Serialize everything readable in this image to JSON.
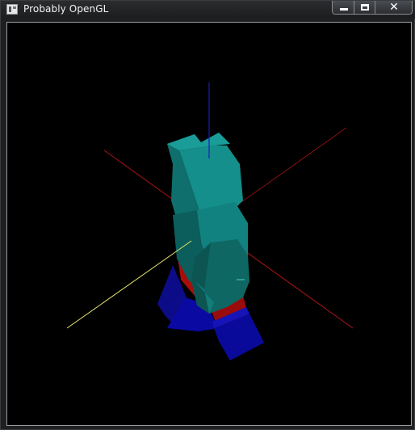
{
  "window": {
    "title": "Probably OpenGL",
    "controls": {
      "minimize_icon": "minimize-icon",
      "maximize_icon": "maximize-icon",
      "close_glyph": "✕"
    }
  },
  "scene": {
    "background": "#000000",
    "axis_colors": {
      "x": "#cc1a1a",
      "y": "#e0e060",
      "z": "#2020d0"
    },
    "object_colors": {
      "teal": "#1a8f8c",
      "red": "#b30f0f",
      "blue": "#101090"
    }
  }
}
